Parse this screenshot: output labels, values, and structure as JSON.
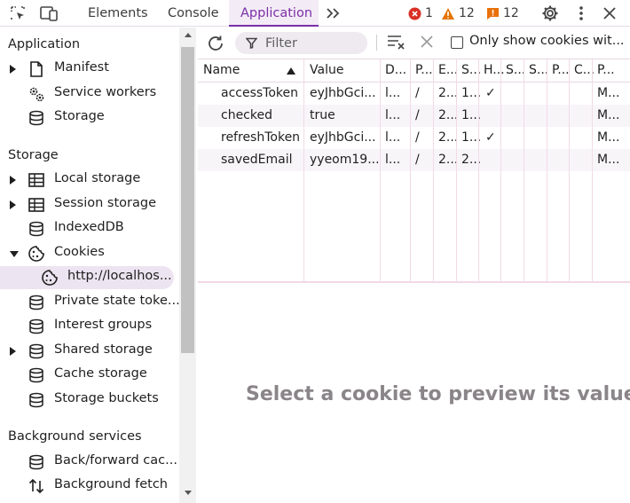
{
  "tabs": [
    {
      "label": "Elements"
    },
    {
      "label": "Console"
    },
    {
      "label": "Application"
    }
  ],
  "badges": {
    "errors": "1",
    "warnings": "12",
    "issues": "12"
  },
  "sidebar": {
    "application_heading": "Application",
    "application_items": [
      {
        "label": "Manifest",
        "icon": "file-icon"
      },
      {
        "label": "Service workers",
        "icon": "gears-icon"
      },
      {
        "label": "Storage",
        "icon": "database-icon"
      }
    ],
    "storage_heading": "Storage",
    "storage_items": [
      {
        "label": "Local storage",
        "icon": "table-icon"
      },
      {
        "label": "Session storage",
        "icon": "table-icon"
      },
      {
        "label": "IndexedDB",
        "icon": "database-icon"
      },
      {
        "label": "Cookies",
        "icon": "cookie-icon"
      },
      {
        "label": "http://localhos...",
        "icon": "cookie-icon"
      },
      {
        "label": "Private state toke...",
        "icon": "database-icon"
      },
      {
        "label": "Interest groups",
        "icon": "database-icon"
      },
      {
        "label": "Shared storage",
        "icon": "database-icon"
      },
      {
        "label": "Cache storage",
        "icon": "database-icon"
      },
      {
        "label": "Storage buckets",
        "icon": "database-icon"
      }
    ],
    "background_heading": "Background services",
    "background_items": [
      {
        "label": "Back/forward cac...",
        "icon": "database-icon"
      },
      {
        "label": "Background fetch",
        "icon": "updown-arrows-icon"
      }
    ]
  },
  "toolbar": {
    "filter_placeholder": "Filter",
    "only_show_label": "Only show cookies wit..."
  },
  "table": {
    "headers": [
      "Name",
      "Value",
      "D...",
      "P...",
      "E...",
      "S...",
      "H...",
      "S...",
      "S...",
      "P...",
      "C...",
      "P..."
    ],
    "rows": [
      [
        "accessToken",
        "eyJhbGci...",
        "l...",
        "/",
        "2...",
        "1...",
        "✓",
        "",
        "",
        "",
        "",
        "M..."
      ],
      [
        "checked",
        "true",
        "l...",
        "/",
        "2...",
        "1...",
        "",
        "",
        "",
        "",
        "",
        "M..."
      ],
      [
        "refreshToken",
        "eyJhbGci...",
        "l...",
        "/",
        "2...",
        "1...",
        "✓",
        "",
        "",
        "",
        "",
        "M..."
      ],
      [
        "savedEmail",
        "yyeom19...",
        "l...",
        "/",
        "2...",
        "2...",
        "",
        "",
        "",
        "",
        "",
        "M..."
      ]
    ]
  },
  "preview": {
    "message": "Select a cookie to preview its value"
  },
  "colors": {
    "accent": "#7b2fa8",
    "error": "#d93025",
    "warning": "#e37400",
    "issue": "#e8710a"
  }
}
